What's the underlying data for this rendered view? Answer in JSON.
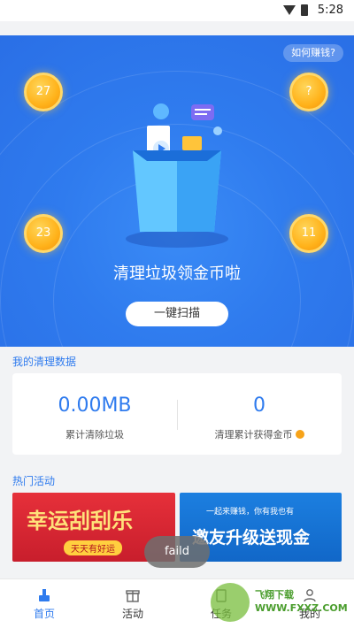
{
  "status_bar": {
    "time": "5:28",
    "icons": [
      "wifi-icon",
      "battery-icon"
    ]
  },
  "hero": {
    "how_to_earn": "如何赚钱?",
    "coins": [
      "27",
      "?",
      "23",
      "11"
    ],
    "title": "清理垃圾领金币啦",
    "scan_button": "一键扫描"
  },
  "stats": {
    "section_title": "我的清理数据",
    "cleaned_value": "0.00MB",
    "cleaned_label": "累计清除垃圾",
    "coins_value": "0",
    "coins_label": "清理累计获得金币"
  },
  "activities": {
    "section_title": "热门活动",
    "banner_left_title": "幸运刮刮乐",
    "banner_left_sub": "天天有好运",
    "banner_right_top": "一起来赚钱，你有我也有",
    "banner_right_title": "邀友升级送现金"
  },
  "toast": "faild",
  "tabs": [
    {
      "label": "首页",
      "icon": "broom-icon"
    },
    {
      "label": "活动",
      "icon": "gift-icon"
    },
    {
      "label": "任务",
      "icon": "task-icon"
    },
    {
      "label": "我的",
      "icon": "user-icon"
    }
  ],
  "watermark": "飞翔下载 WWW.FXXZ.COM",
  "colors": {
    "primary": "#2f7bee",
    "coin": "#ffb21a",
    "banner_red": "#e6303a",
    "banner_blue": "#1c7fe0"
  }
}
